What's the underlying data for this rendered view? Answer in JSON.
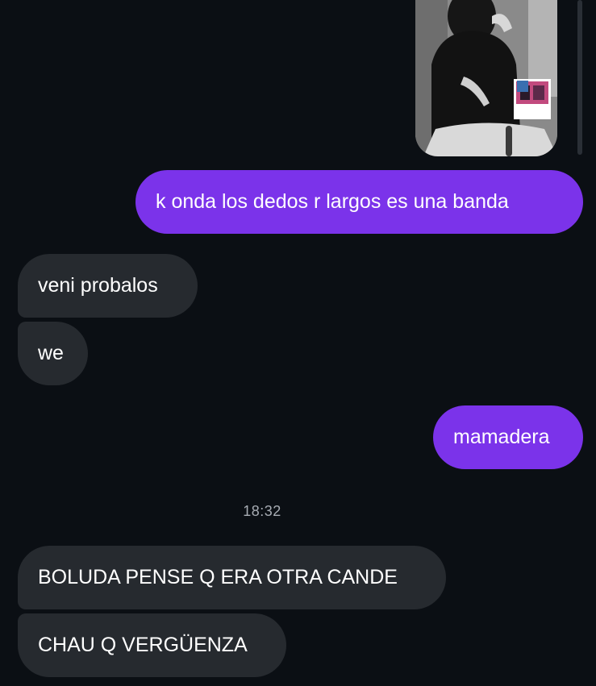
{
  "conversation": {
    "messages": [
      {
        "sender": "me",
        "type": "image",
        "label": ""
      },
      {
        "sender": "me",
        "type": "text",
        "text": "k onda los dedos r largos es una banda"
      },
      {
        "sender": "them",
        "type": "text",
        "text": "veni probalos"
      },
      {
        "sender": "them",
        "type": "text",
        "text": "we"
      },
      {
        "sender": "me",
        "type": "text",
        "text": "mamadera"
      },
      {
        "sender": "them",
        "type": "text",
        "text": "BOLUDA PENSE Q ERA OTRA CANDE"
      },
      {
        "sender": "them",
        "type": "text",
        "text": "CHAU Q VERGÜENZA"
      }
    ],
    "timestamp": "18:32"
  },
  "colors": {
    "background": "#0b0f14",
    "outgoing_bubble": "#7b33ea",
    "incoming_bubble": "#262a2f",
    "timestamp_text": "#a7acb3"
  }
}
